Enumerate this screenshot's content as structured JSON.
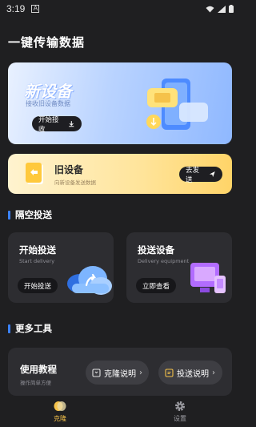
{
  "status_bar": {
    "time": "3:19",
    "app_indicator": "A"
  },
  "header": {
    "title": "一键传输数据"
  },
  "new_device_card": {
    "title": "新设备",
    "subtitle": "接收旧设备数据",
    "button_label": "开始接收"
  },
  "old_device_card": {
    "title": "旧设备",
    "subtitle": "向新设备发送数据",
    "button_label": "去发送"
  },
  "airdrop_section": {
    "title": "隔空投送",
    "tiles": [
      {
        "title": "开始投送",
        "subtitle": "Start delivery",
        "button_label": "开始投送"
      },
      {
        "title": "投送设备",
        "subtitle": "Delivery equipment",
        "button_label": "立即查看"
      }
    ]
  },
  "tools_section": {
    "title": "更多工具",
    "card": {
      "title": "使用教程",
      "subtitle": "操作简单方便",
      "buttons": [
        {
          "label": "克隆说明"
        },
        {
          "label": "投送说明"
        }
      ]
    }
  },
  "tabbar": {
    "tabs": [
      {
        "label": "克隆",
        "icon": "clone-icon",
        "active": true
      },
      {
        "label": "设置",
        "icon": "settings-gear-icon",
        "active": false
      }
    ]
  },
  "colors": {
    "background": "#1f1f21",
    "accent_blue": "#3b82ff",
    "accent_yellow": "#f5c24a",
    "card_dark": "#2d2d31"
  }
}
